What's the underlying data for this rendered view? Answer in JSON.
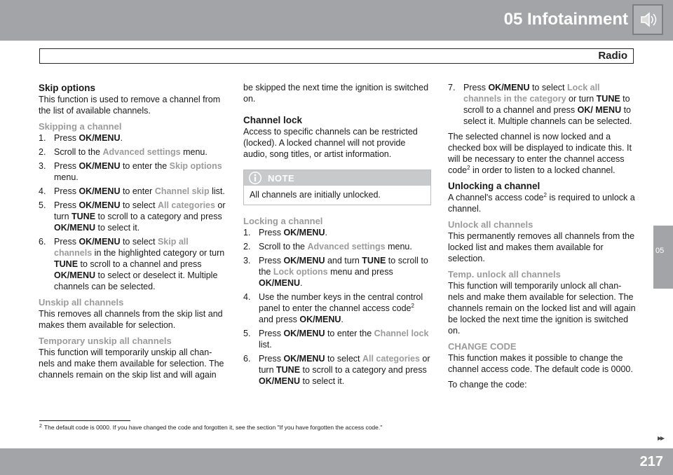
{
  "header": {
    "chapter": "05 Infotainment",
    "section": "Radio",
    "side_tab": "05"
  },
  "col1": {
    "skip_title": "Skip options",
    "skip_intro": "This function is used to remove a channel from the list of available channels.",
    "skipping_title": "Skipping a channel",
    "steps": [
      {
        "n": "1.",
        "a": "Press ",
        "k1": "OK/MENU",
        "b": "."
      },
      {
        "n": "2.",
        "a": "Scroll to the ",
        "g1": "Advanced settings",
        "b": " menu."
      },
      {
        "n": "3.",
        "a": "Press ",
        "k1": "OK/MENU",
        "b": " to enter the ",
        "g1": "Skip options",
        "c": " menu."
      },
      {
        "n": "4.",
        "a": "Press ",
        "k1": "OK/MENU",
        "b": " to enter ",
        "g1": "Channel skip",
        "c": " list."
      },
      {
        "n": "5.",
        "a": "Press ",
        "k1": "OK/MENU",
        "b": " to select ",
        "g1": "All categories",
        "c": " or turn ",
        "k2": "TUNE",
        "d": " to scroll to a category and press ",
        "k3": "OK/MENU",
        "e": " to select it."
      },
      {
        "n": "6.",
        "a": "Press ",
        "k1": "OK/MENU",
        "b": " to select ",
        "g1": "Skip all channels",
        "c": " in the highlighted category or turn ",
        "k2": "TUNE",
        "d": " to scroll to a channel and press ",
        "k3": "OK/MENU",
        "e": " to select or deselect it. Multiple channels can be selected."
      }
    ],
    "unskip_title": "Unskip all channels",
    "unskip_text": "This removes all channels from the skip list and makes them available for selection.",
    "temp_title": "Temporary unskip all channels",
    "temp_text": "This function will temporarily unskip all chan-nels and make them available for selection. The channels remain on the skip list and will again"
  },
  "col2": {
    "cont_text": "be skipped the next time the ignition is switched on.",
    "lock_title": "Channel lock",
    "lock_text": "Access to specific channels can be restricted (locked). A locked channel will not provide audio, song titles, or artist information.",
    "note_title": "NOTE",
    "note_text": "All channels are initially unlocked.",
    "locking_title": "Locking a channel",
    "steps": [
      {
        "n": "1.",
        "a": "Press ",
        "k1": "OK/MENU",
        "b": "."
      },
      {
        "n": "2.",
        "a": "Scroll to the ",
        "g1": "Advanced settings",
        "b": " menu."
      },
      {
        "n": "3.",
        "a": "Press ",
        "k1": "OK/MENU",
        "b": " and turn ",
        "k2": "TUNE",
        "c": " to scroll to the ",
        "g1": "Lock options",
        "d": " menu and press ",
        "k3": "OK/MENU",
        "e": "."
      },
      {
        "n": "4.",
        "a": "Use the number keys in the central control panel to enter the channel access code",
        "sup": "2",
        "b": " and press ",
        "k1": "OK/MENU",
        "c": "."
      },
      {
        "n": "5.",
        "a": "Press ",
        "k1": "OK/MENU",
        "b": " to enter the ",
        "g1": "Channel lock",
        "c": " list."
      },
      {
        "n": "6.",
        "a": "Press ",
        "k1": "OK/MENU",
        "b": " to select ",
        "g1": "All categories",
        "c": " or turn ",
        "k2": "TUNE",
        "d": " to scroll to a category and press ",
        "k3": "OK/MENU",
        "e": " to select it."
      }
    ]
  },
  "col3": {
    "step7": {
      "n": "7.",
      "a": "Press ",
      "k1": "OK/MENU",
      "b": " to select ",
      "g1": "Lock all channels in the category",
      "c": " or turn ",
      "k2": "TUNE",
      "d": " to scroll to a channel and press ",
      "k3": "OK/ MENU",
      "e": " to select it. Multiple channels can be selected."
    },
    "selected_text_a": "The selected channel is now locked and a checked box will be displayed to indicate this. It will be necessary to enter the channel access code",
    "selected_sup": "2",
    "selected_text_b": " in order to listen to a locked channel.",
    "unlocking_title": "Unlocking a channel",
    "unlocking_text_a": "A channel's access code",
    "unlocking_sup": "2",
    "unlocking_text_b": " is required to unlock a channel.",
    "unlock_all_title": "Unlock all channels",
    "unlock_all_text": "This permanently removes all channels from the locked list and makes them available for selection.",
    "temp_unlock_title": "Temp. unlock all channels",
    "temp_unlock_text": "This function will temporarily unlock all chan-nels and make them available for selection. The channels remain on the locked list and will again be locked the next time the ignition is switched on.",
    "change_title": "CHANGE CODE",
    "change_text": "This function makes it possible to change the channel access code. The default code is 0000.",
    "change_to": "To change the code:"
  },
  "footnote": {
    "mark": "2",
    "text": "The default code is 0000. If you have changed the code and forgotten it, see the section \"If you have forgotten the access code.\""
  },
  "footer": {
    "page": "217",
    "arrows": "▸▸"
  }
}
